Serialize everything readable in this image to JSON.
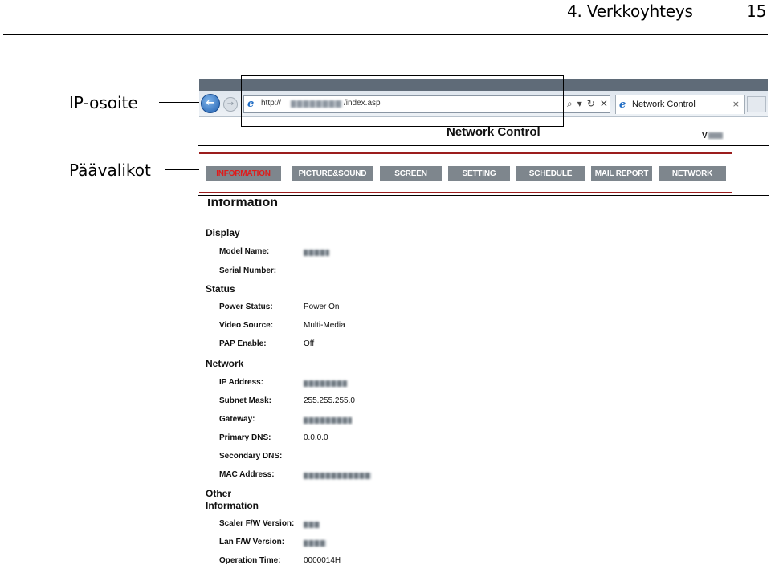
{
  "manual": {
    "chapter_title": "4. Verkkoyhteys",
    "page_number": "15",
    "callout_ip": "IP-osoite",
    "callout_menu": "Päävalikot"
  },
  "browser": {
    "url_prefix": "http://",
    "url_path": "/index.asp",
    "tab_title": "Network Control",
    "tab_close": "×",
    "tools": [
      "⌕",
      "▾",
      "↻",
      "✕"
    ]
  },
  "page": {
    "heading": "Network Control",
    "version": "V",
    "info_heading": "Information"
  },
  "menu": {
    "items": [
      "INFORMATION",
      "PICTURE&SOUND",
      "SCREEN",
      "SETTING",
      "SCHEDULE",
      "MAIL REPORT",
      "NETWORK"
    ],
    "active_color": "#e01b1b",
    "bar_color": "#7e868d",
    "rule_color": "#9b1d1d"
  },
  "sections": {
    "display": {
      "title": "Display",
      "fields": [
        {
          "label": "Model Name:",
          "value": null
        },
        {
          "label": "Serial Number:",
          "value": ""
        }
      ]
    },
    "status": {
      "title": "Status",
      "fields": [
        {
          "label": "Power Status:",
          "value": "Power On"
        },
        {
          "label": "Video Source:",
          "value": "Multi-Media"
        },
        {
          "label": "PAP Enable:",
          "value": "Off"
        }
      ]
    },
    "network": {
      "title": "Network",
      "fields": [
        {
          "label": "IP Address:",
          "value": null
        },
        {
          "label": "Subnet Mask:",
          "value": "255.255.255.0"
        },
        {
          "label": "Gateway:",
          "value": null
        },
        {
          "label": "Primary DNS:",
          "value": "0.0.0.0"
        },
        {
          "label": "Secondary DNS:",
          "value": ""
        },
        {
          "label": "MAC Address:",
          "value": null
        }
      ]
    },
    "other": {
      "title_line1": "Other",
      "title_line2": "Information",
      "fields": [
        {
          "label": "Scaler F/W Version:",
          "value": null
        },
        {
          "label": "Lan F/W Version:",
          "value": null
        },
        {
          "label": "Operation Time:",
          "value": "0000014H"
        }
      ]
    }
  }
}
